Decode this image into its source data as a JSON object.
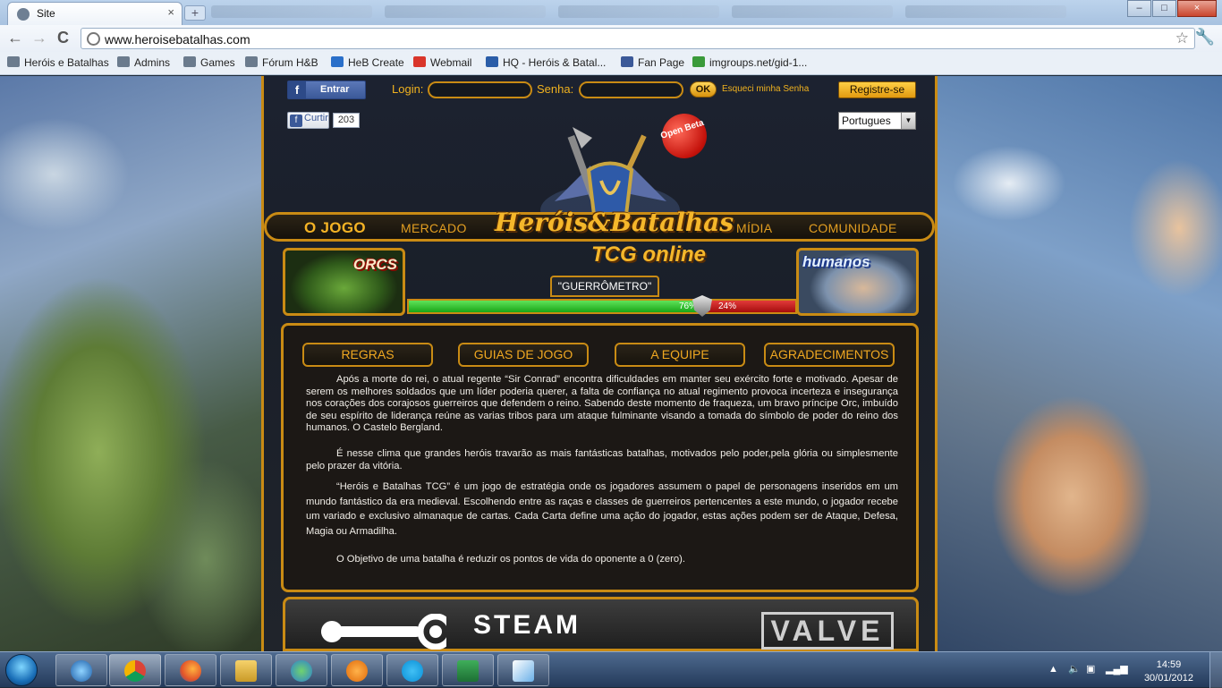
{
  "browser": {
    "tab_title": "Site",
    "tab_close": "×",
    "new_tab": "+",
    "url": "www.heroisebatalhas.com",
    "buttons": {
      "back": "←",
      "forward": "→",
      "reload": "C",
      "star": "☆",
      "menu": "🔧",
      "minimize": "–",
      "maximize": "□",
      "close": "×"
    },
    "bookmarks": [
      "Heróis e Batalhas",
      "Admins",
      "Games",
      "Fórum H&B",
      "HeB Create",
      "Webmail",
      "HQ - Heróis & Batal...",
      "Fan Page",
      "imgroups.net/gid-1..."
    ]
  },
  "header": {
    "facebook_login": "Entrar",
    "login_label": "Login:",
    "password_label": "Senha:",
    "ok_button": "OK",
    "forgot_password": "Esqueci minha Senha",
    "register_button": "Registre-se",
    "like_button": "Curtir",
    "like_count": "203",
    "language": "Portugues"
  },
  "logo": {
    "badge": "Open Beta",
    "title": "Heróis&Batalhas",
    "subtitle": "TCG online"
  },
  "main_nav": [
    "O JOGO",
    "MERCADO",
    "MÍDIA",
    "COMUNIDADE"
  ],
  "factions": {
    "left": "ORCS",
    "right": "humanos"
  },
  "war_meter": {
    "title": "\"GUERRÔMETRO\"",
    "left_percent": 76,
    "right_percent": 24,
    "left_label": "76%",
    "right_label": "24%"
  },
  "sub_nav": [
    "REGRAS",
    "GUIAS DE JOGO",
    "A EQUIPE",
    "AGRADECIMENTOS"
  ],
  "content": [
    "Após a morte do rei, o atual regente “Sir Conrad” encontra dificuldades em manter seu exército forte e motivado. Apesar de serem os melhores soldados que um líder poderia querer, a falta de confiança no atual regimento provoca incerteza e insegurança nos corações dos corajosos guerreiros que defendem o reino. Sabendo deste momento de fraqueza, um bravo príncipe Orc, imbuído de seu espírito de liderança reúne as varias tribos para um ataque fulminante visando a tomada do símbolo de poder do reino dos humanos. O Castelo Bergland.",
    "É nesse clima que grandes heróis travarão as mais fantásticas batalhas, motivados pelo poder,pela glória ou simplesmente pelo prazer da vitória.",
    "“Heróis e Batalhas TCG” é um jogo de estratégia onde os jogadores assumem o papel de personagens inseridos em um mundo fantástico da era medieval. Escolhendo entre as raças e classes de guerreiros pertencentes a este mundo, o jogador recebe um variado e exclusivo almanaque de cartas. Cada Carta define uma ação do jogador, estas ações podem ser de Ataque, Defesa, Magia ou Armadilha.",
    "O Objetivo de uma batalha é reduzir os pontos de vida do oponente a 0 (zero)."
  ],
  "banner": {
    "steam": "STEAM",
    "valve": "VALVE"
  },
  "taskbar": {
    "time": "14:59",
    "date": "30/01/2012"
  },
  "colors": {
    "gold": "#c98b14",
    "orange_text": "#f0b21f",
    "facebook": "#3b5998",
    "green": "#19a619",
    "red": "#a50d0d"
  }
}
